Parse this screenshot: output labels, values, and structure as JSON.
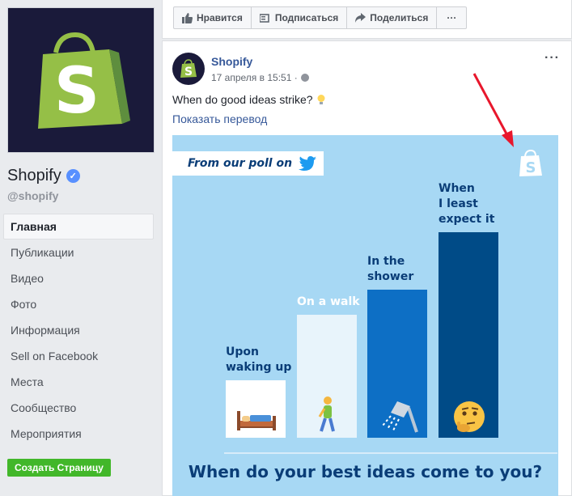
{
  "page": {
    "name": "Shopify",
    "handle": "@shopify",
    "verified_mark": "✓",
    "nav": [
      "Главная",
      "Публикации",
      "Видео",
      "Фото",
      "Информация",
      "Sell on Facebook",
      "Места",
      "Сообщество",
      "Мероприятия"
    ],
    "create_button": "Создать Страницу"
  },
  "actions": {
    "like": "Нравится",
    "follow": "Подписаться",
    "share": "Поделиться",
    "more": "···"
  },
  "post": {
    "author": "Shopify",
    "time": "17 апреля в 15:51 ·",
    "more": "···",
    "text": "When do good ideas strike?",
    "translate": "Показать перевод"
  },
  "graphic": {
    "poll_tag": "From our poll on",
    "bars": [
      {
        "label_1": "Upon",
        "label_2": "waking up",
        "label_3": "",
        "level": 0.28
      },
      {
        "label_1": "On a walk",
        "label_2": "",
        "label_3": "",
        "level": 0.6
      },
      {
        "label_1": "In the",
        "label_2": "shower",
        "label_3": "",
        "level": 0.72
      },
      {
        "label_1": "When",
        "label_2": "I least",
        "label_3": "expect it",
        "level": 1.0
      }
    ],
    "question": "When do your best ideas come to you?"
  },
  "colors": {
    "brand_green": "#95bf47",
    "facebook_blue": "#365899",
    "create_green": "#42b72a",
    "bar_1": "#ffffff",
    "bar_2": "#e8f4fb",
    "bar_3": "#0d6fc5",
    "bar_4": "#004b87",
    "arrow": "#e8172c"
  },
  "icons": [
    "shopify-bag-icon",
    "verified-icon",
    "thumbs-up-icon",
    "follow-icon",
    "share-icon",
    "globe-icon",
    "lightbulb-icon",
    "twitter-icon",
    "bed-icon",
    "walker-icon",
    "shower-icon",
    "thinking-face-icon",
    "red-arrow-icon"
  ]
}
